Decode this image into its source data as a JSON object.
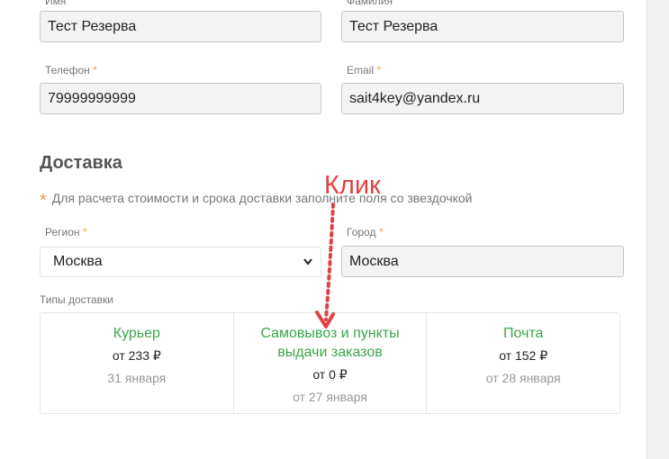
{
  "form": {
    "first_name": {
      "label": "Имя",
      "value": "Тест Резерва"
    },
    "last_name": {
      "label": "Фамилия",
      "value": "Тест Резерва"
    },
    "phone": {
      "label": "Телефон",
      "required": "*",
      "value": "79999999999"
    },
    "email": {
      "label": "Email",
      "required": "*",
      "value": "sait4key@yandex.ru"
    }
  },
  "delivery": {
    "title": "Доставка",
    "hint_star": "*",
    "hint": "Для расчета стоимости и срока доставки заполните поля со звездочкой",
    "region": {
      "label": "Регион",
      "required": "*",
      "value": "Москва",
      "icon": "chevron-down-icon"
    },
    "city": {
      "label": "Город",
      "required": "*",
      "value": "Москва"
    },
    "types_label": "Типы доставки",
    "types": [
      {
        "name": "Курьер",
        "price": "от 233 ₽",
        "date": "31 января"
      },
      {
        "name": "Самовывоз и пункты выдачи заказов",
        "price": "от 0 ₽",
        "date": "от 27 января"
      },
      {
        "name": "Почта",
        "price": "от 152 ₽",
        "date": "от 28 января"
      }
    ]
  },
  "annotation": {
    "text": "Клик",
    "color": "#e04242"
  },
  "colors": {
    "accent_green": "#3aa64a",
    "required_orange": "#f0a050"
  }
}
